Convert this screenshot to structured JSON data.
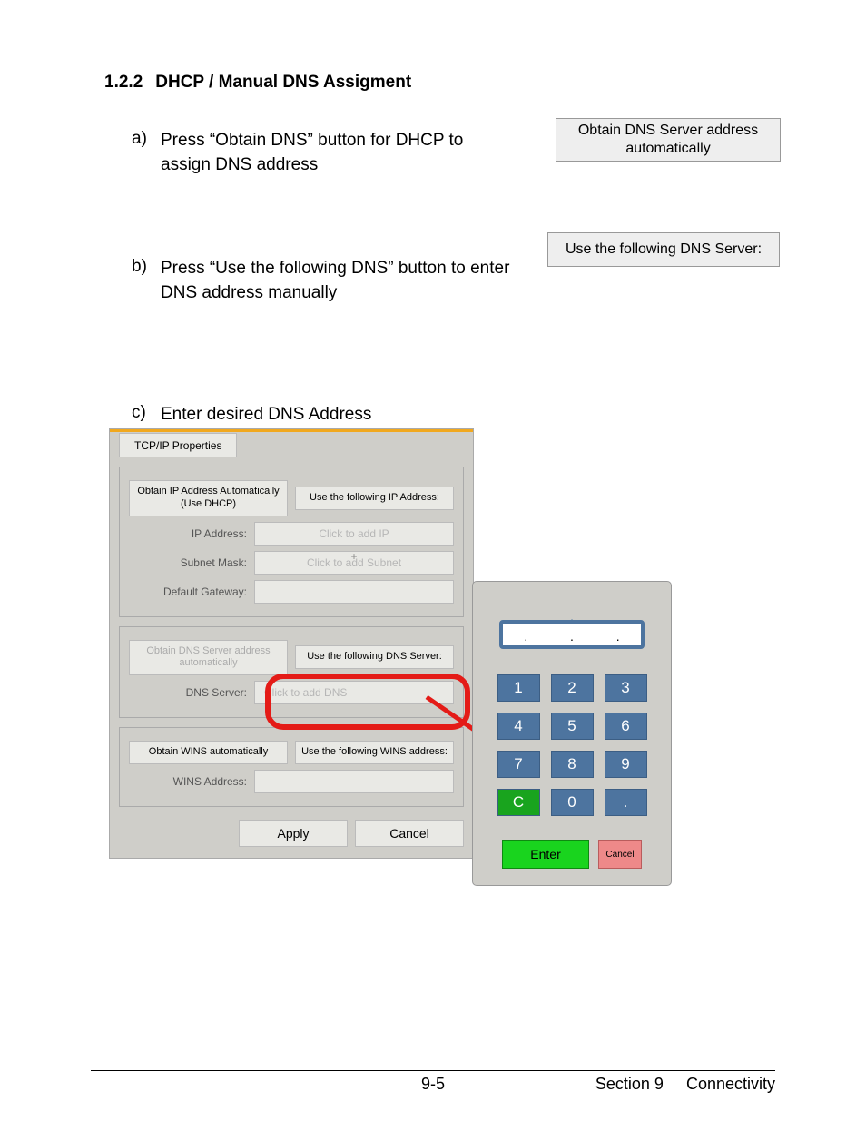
{
  "heading": {
    "number": "1.2.2",
    "title": "DHCP / Manual DNS Assigment"
  },
  "items": {
    "a": {
      "marker": "a)",
      "text": "Press “Obtain DNS” button for DHCP to assign DNS address"
    },
    "b": {
      "marker": "b)",
      "text": "Press “Use the following DNS” button to enter DNS address manually"
    },
    "c": {
      "marker": "c)",
      "text": "Enter desired DNS Address"
    }
  },
  "side_buttons": {
    "obtain_dns": "Obtain DNS Server address automatically",
    "use_dns": "Use the following DNS Server:"
  },
  "tcpip": {
    "tab": "TCP/IP Properties",
    "ip_section": {
      "auto": "Obtain IP Address Automatically (Use DHCP)",
      "manual": "Use the following IP Address:",
      "ip_label": "IP Address:",
      "ip_placeholder": "Click to add IP",
      "subnet_label": "Subnet Mask:",
      "subnet_placeholder": "Click to add Subnet",
      "gateway_label": "Default Gateway:"
    },
    "dns_section": {
      "auto": "Obtain DNS Server address automatically",
      "manual": "Use the following DNS Server:",
      "dns_label": "DNS Server:",
      "dns_placeholder": "Click to add DNS"
    },
    "wins_section": {
      "auto": "Obtain WINS automatically",
      "manual": "Use the following WINS address:",
      "wins_label": "WINS Address:"
    },
    "apply": "Apply",
    "cancel": "Cancel"
  },
  "keypad": {
    "display_dots": [
      ".",
      ".",
      "."
    ],
    "keys": {
      "1": "1",
      "2": "2",
      "3": "3",
      "4": "4",
      "5": "5",
      "6": "6",
      "7": "7",
      "8": "8",
      "9": "9",
      "c": "C",
      "0": "0",
      "dot": "."
    },
    "enter": "Enter",
    "cancel": "Cancel"
  },
  "footer": {
    "page": "9-5",
    "section": "Section 9",
    "title": "Connectivity"
  }
}
